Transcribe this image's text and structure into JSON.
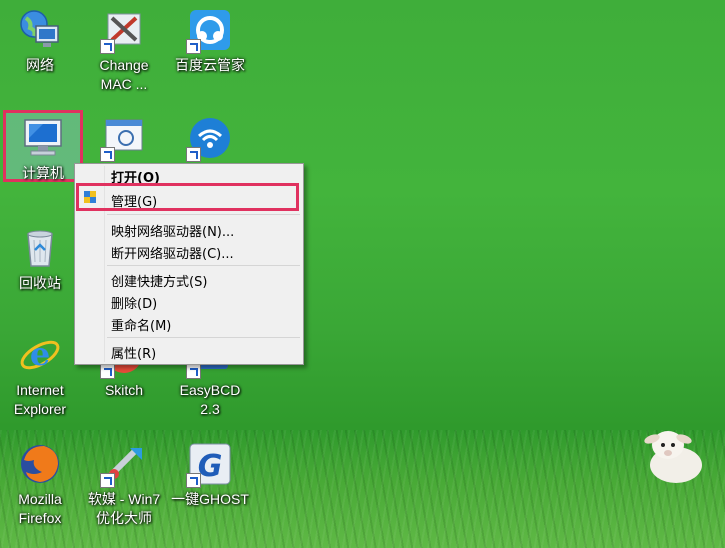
{
  "desktop_icons": {
    "network": {
      "label": "网络",
      "icon": "network-icon"
    },
    "change_mac": {
      "label_line1": "Change",
      "label_line2": "MAC ...",
      "icon": "change-mac-icon"
    },
    "baidu": {
      "label": "百度云管家",
      "icon": "baidu-cloud-icon"
    },
    "computer": {
      "label": "计算机",
      "icon": "computer-icon"
    },
    "recycle": {
      "label": "回收站",
      "icon": "recycle-bin-icon"
    },
    "ie": {
      "label_line1": "Internet",
      "label_line2": "Explorer",
      "icon": "internet-explorer-icon"
    },
    "skitch": {
      "label": "Skitch",
      "icon": "skitch-icon"
    },
    "easybcd": {
      "label_line1": "EasyBCD",
      "label_line2": "2.3",
      "icon": "easybcd-icon"
    },
    "firefox": {
      "label_line1": "Mozilla",
      "label_line2": "Firefox",
      "icon": "firefox-icon"
    },
    "ruanmei": {
      "label_line1": "软媒 - Win7",
      "label_line2": "优化大师",
      "icon": "ruanmei-icon"
    },
    "ghost": {
      "label": "一键GHOST",
      "icon": "ghost-icon"
    }
  },
  "context_menu": {
    "open": "打开(O)",
    "manage": "管理(G)",
    "map_drive": "映射网络驱动器(N)...",
    "disconnect_drive": "断开网络驱动器(C)...",
    "create_shortcut": "创建快捷方式(S)",
    "delete": "删除(D)",
    "rename": "重命名(M)",
    "properties": "属性(R)"
  },
  "colors": {
    "highlight": "#e0315f",
    "desktop": "#43b43c"
  }
}
